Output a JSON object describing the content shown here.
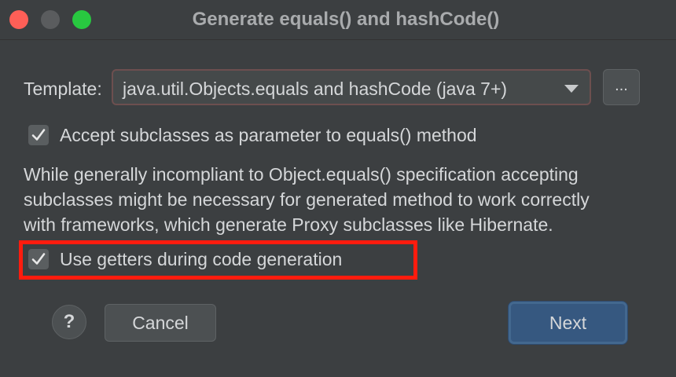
{
  "window": {
    "title": "Generate equals() and hashCode()"
  },
  "template": {
    "label": "Template:",
    "selected": "java.util.Objects.equals and hashCode (java 7+)",
    "browse_label": "..."
  },
  "options": {
    "accept_subclasses": {
      "label": "Accept subclasses as parameter to equals() method",
      "checked": true
    },
    "description_lines": [
      "While generally incompliant to Object.equals() specification accepting",
      "subclasses might be necessary for generated method to work correctly",
      "with frameworks, which generate Proxy subclasses like Hibernate."
    ],
    "use_getters": {
      "label": "Use getters during code generation",
      "checked": true
    }
  },
  "footer": {
    "help_label": "?",
    "cancel_label": "Cancel",
    "next_label": "Next"
  },
  "colors": {
    "background": "#3c3f41",
    "highlight": "#ff1c0e",
    "primary_button": "#365880",
    "close": "#fe5f57",
    "maximize": "#28c840"
  },
  "icons": [
    "close-icon",
    "minimize-icon",
    "maximize-icon",
    "dropdown-arrow-icon",
    "checkmark-icon",
    "help-icon"
  ]
}
